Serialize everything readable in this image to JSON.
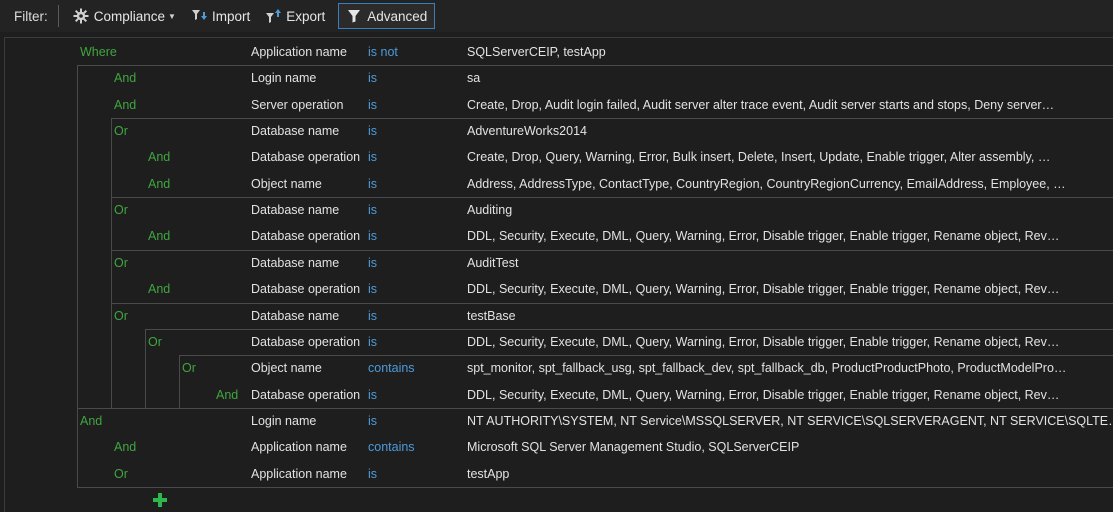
{
  "toolbar": {
    "filter_label": "Filter:",
    "compliance_label": "Compliance",
    "import_label": "Import",
    "export_label": "Export",
    "advanced_label": "Advanced"
  },
  "rows": [
    {
      "op": "Where",
      "field": "Application name",
      "cmp": "is not",
      "value": "SQLServerCEIP, testApp"
    },
    {
      "op": "And",
      "field": "Login name",
      "cmp": "is",
      "value": "sa"
    },
    {
      "op": "And",
      "field": "Server operation",
      "cmp": "is",
      "value": "Create, Drop, Audit login failed, Audit server alter trace event, Audit server starts and stops, Deny server…"
    },
    {
      "op": "Or",
      "field": "Database name",
      "cmp": "is",
      "value": "AdventureWorks2014"
    },
    {
      "op": "And",
      "field": "Database operation",
      "cmp": "is",
      "value": "Create, Drop, Query, Warning, Error, Bulk insert, Delete, Insert, Update, Enable trigger, Alter assembly, …"
    },
    {
      "op": "And",
      "field": "Object name",
      "cmp": "is",
      "value": "Address, AddressType, ContactType, CountryRegion, CountryRegionCurrency, EmailAddress, Employee, …"
    },
    {
      "op": "Or",
      "field": "Database name",
      "cmp": "is",
      "value": "Auditing"
    },
    {
      "op": "And",
      "field": "Database operation",
      "cmp": "is",
      "value": "DDL, Security, Execute, DML, Query, Warning, Error, Disable trigger, Enable trigger, Rename object, Rev…"
    },
    {
      "op": "Or",
      "field": "Database name",
      "cmp": "is",
      "value": "AuditTest"
    },
    {
      "op": "And",
      "field": "Database operation",
      "cmp": "is",
      "value": "DDL, Security, Execute, DML, Query, Warning, Error, Disable trigger, Enable trigger, Rename object, Rev…"
    },
    {
      "op": "Or",
      "field": "Database name",
      "cmp": "is",
      "value": "testBase"
    },
    {
      "op": "Or",
      "field": "Database operation",
      "cmp": "is",
      "value": "DDL, Security, Execute, DML, Query, Warning, Error, Disable trigger, Enable trigger, Rename object, Rev…"
    },
    {
      "op": "Or",
      "field": "Object name",
      "cmp": "contains",
      "value": "spt_monitor, spt_fallback_usg, spt_fallback_dev, spt_fallback_db, ProductProductPhoto, ProductModelPro…"
    },
    {
      "op": "And",
      "field": "Database operation",
      "cmp": "is",
      "value": "DDL, Security, Execute, DML, Query, Warning, Error, Disable trigger, Enable trigger, Rename object, Rev…"
    },
    {
      "op": "And",
      "field": "Login name",
      "cmp": "is",
      "value": "NT AUTHORITY\\SYSTEM, NT Service\\MSSQLSERVER, NT SERVICE\\SQLSERVERAGENT, NT SERVICE\\SQLTE…"
    },
    {
      "op": "And",
      "field": "Application name",
      "cmp": "contains",
      "value": "Microsoft SQL Server Management Studio, SQLServerCEIP"
    },
    {
      "op": "Or",
      "field": "Application name",
      "cmp": "is",
      "value": "testApp"
    }
  ],
  "colors": {
    "operator": "#3fa63f",
    "comparator": "#4c9bdb",
    "add": "#2fb84a"
  },
  "icons": {
    "compliance": "gear-icon",
    "import": "import-icon",
    "export": "export-icon",
    "advanced": "funnel-icon",
    "add": "plus-icon"
  }
}
